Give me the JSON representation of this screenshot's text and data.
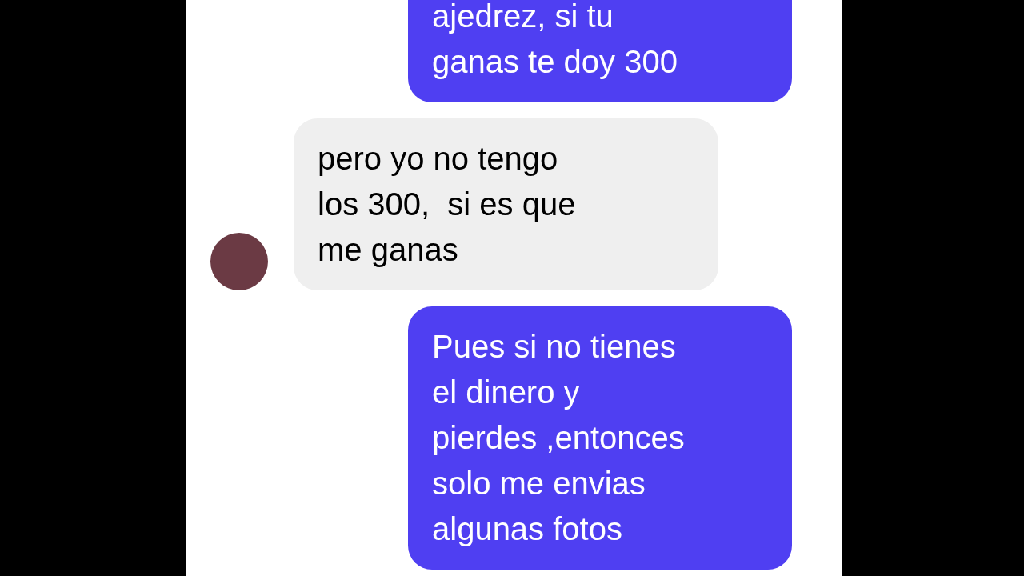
{
  "messages": [
    {
      "kind": "sent",
      "text": "ajedrez, si tu\nganas te doy 300"
    },
    {
      "kind": "received",
      "text": "pero yo no tengo\nlos 300,  si es que\nme ganas"
    },
    {
      "kind": "sent",
      "text": "Pues si no tienes\nel dinero y\npierdes ,entonces\nsolo me envias\nalgunas fotos"
    }
  ]
}
